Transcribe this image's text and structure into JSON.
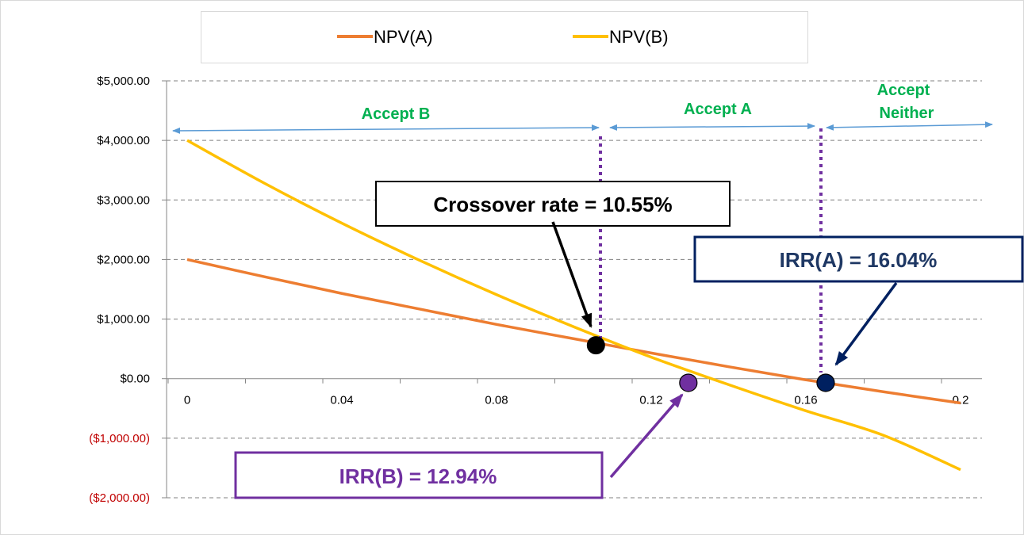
{
  "chart_data": {
    "type": "line",
    "x": [
      0,
      0.02,
      0.04,
      0.06,
      0.08,
      0.1,
      0.12,
      0.14,
      0.16,
      0.18,
      0.2
    ],
    "x_ticks": [
      "0",
      "0.04",
      "0.08",
      "0.12",
      "0.16",
      "0.2"
    ],
    "y_ticks": [
      "$5,000.00",
      "$4,000.00",
      "$3,000.00",
      "$2,000.00",
      "$1,000.00",
      "$0.00",
      "($1,000.00)",
      "($2,000.00)"
    ],
    "ylim": [
      -2000,
      5000
    ],
    "grid": "horizontal dashed",
    "legend": "top",
    "series": [
      {
        "name": "NPV(A)",
        "color": "#ed7d31",
        "values": [
          2000,
          1710,
          1430,
          1170,
          910,
          670,
          430,
          200,
          -20,
          -220,
          -410
        ]
      },
      {
        "name": "NPV(B)",
        "color": "#ffc000",
        "values": [
          4000,
          3280,
          2610,
          1990,
          1410,
          870,
          360,
          -100,
          -540,
          -950,
          -1530
        ]
      }
    ],
    "annotations": {
      "regions": [
        {
          "label": "Accept B"
        },
        {
          "label": "Accept A"
        },
        {
          "label_line1": "Accept",
          "label_line2": "Neither"
        }
      ],
      "crossover": {
        "label": "Crossover rate = 10.55%",
        "x": 0.1055,
        "y": 560,
        "color": "#000000",
        "border": "#000000"
      },
      "irr_a": {
        "label": "IRR(A) = 16.04%",
        "x": 0.1604,
        "y": -70,
        "color": "#1f3864",
        "border": "#002060"
      },
      "irr_b": {
        "label": "IRR(B) = 12.94%",
        "x": 0.1294,
        "y": -70,
        "color": "#7030a0",
        "border": "#7030a0"
      },
      "divider_color": "#7030a0",
      "region_arrow_color": "#5b9bd5"
    }
  }
}
